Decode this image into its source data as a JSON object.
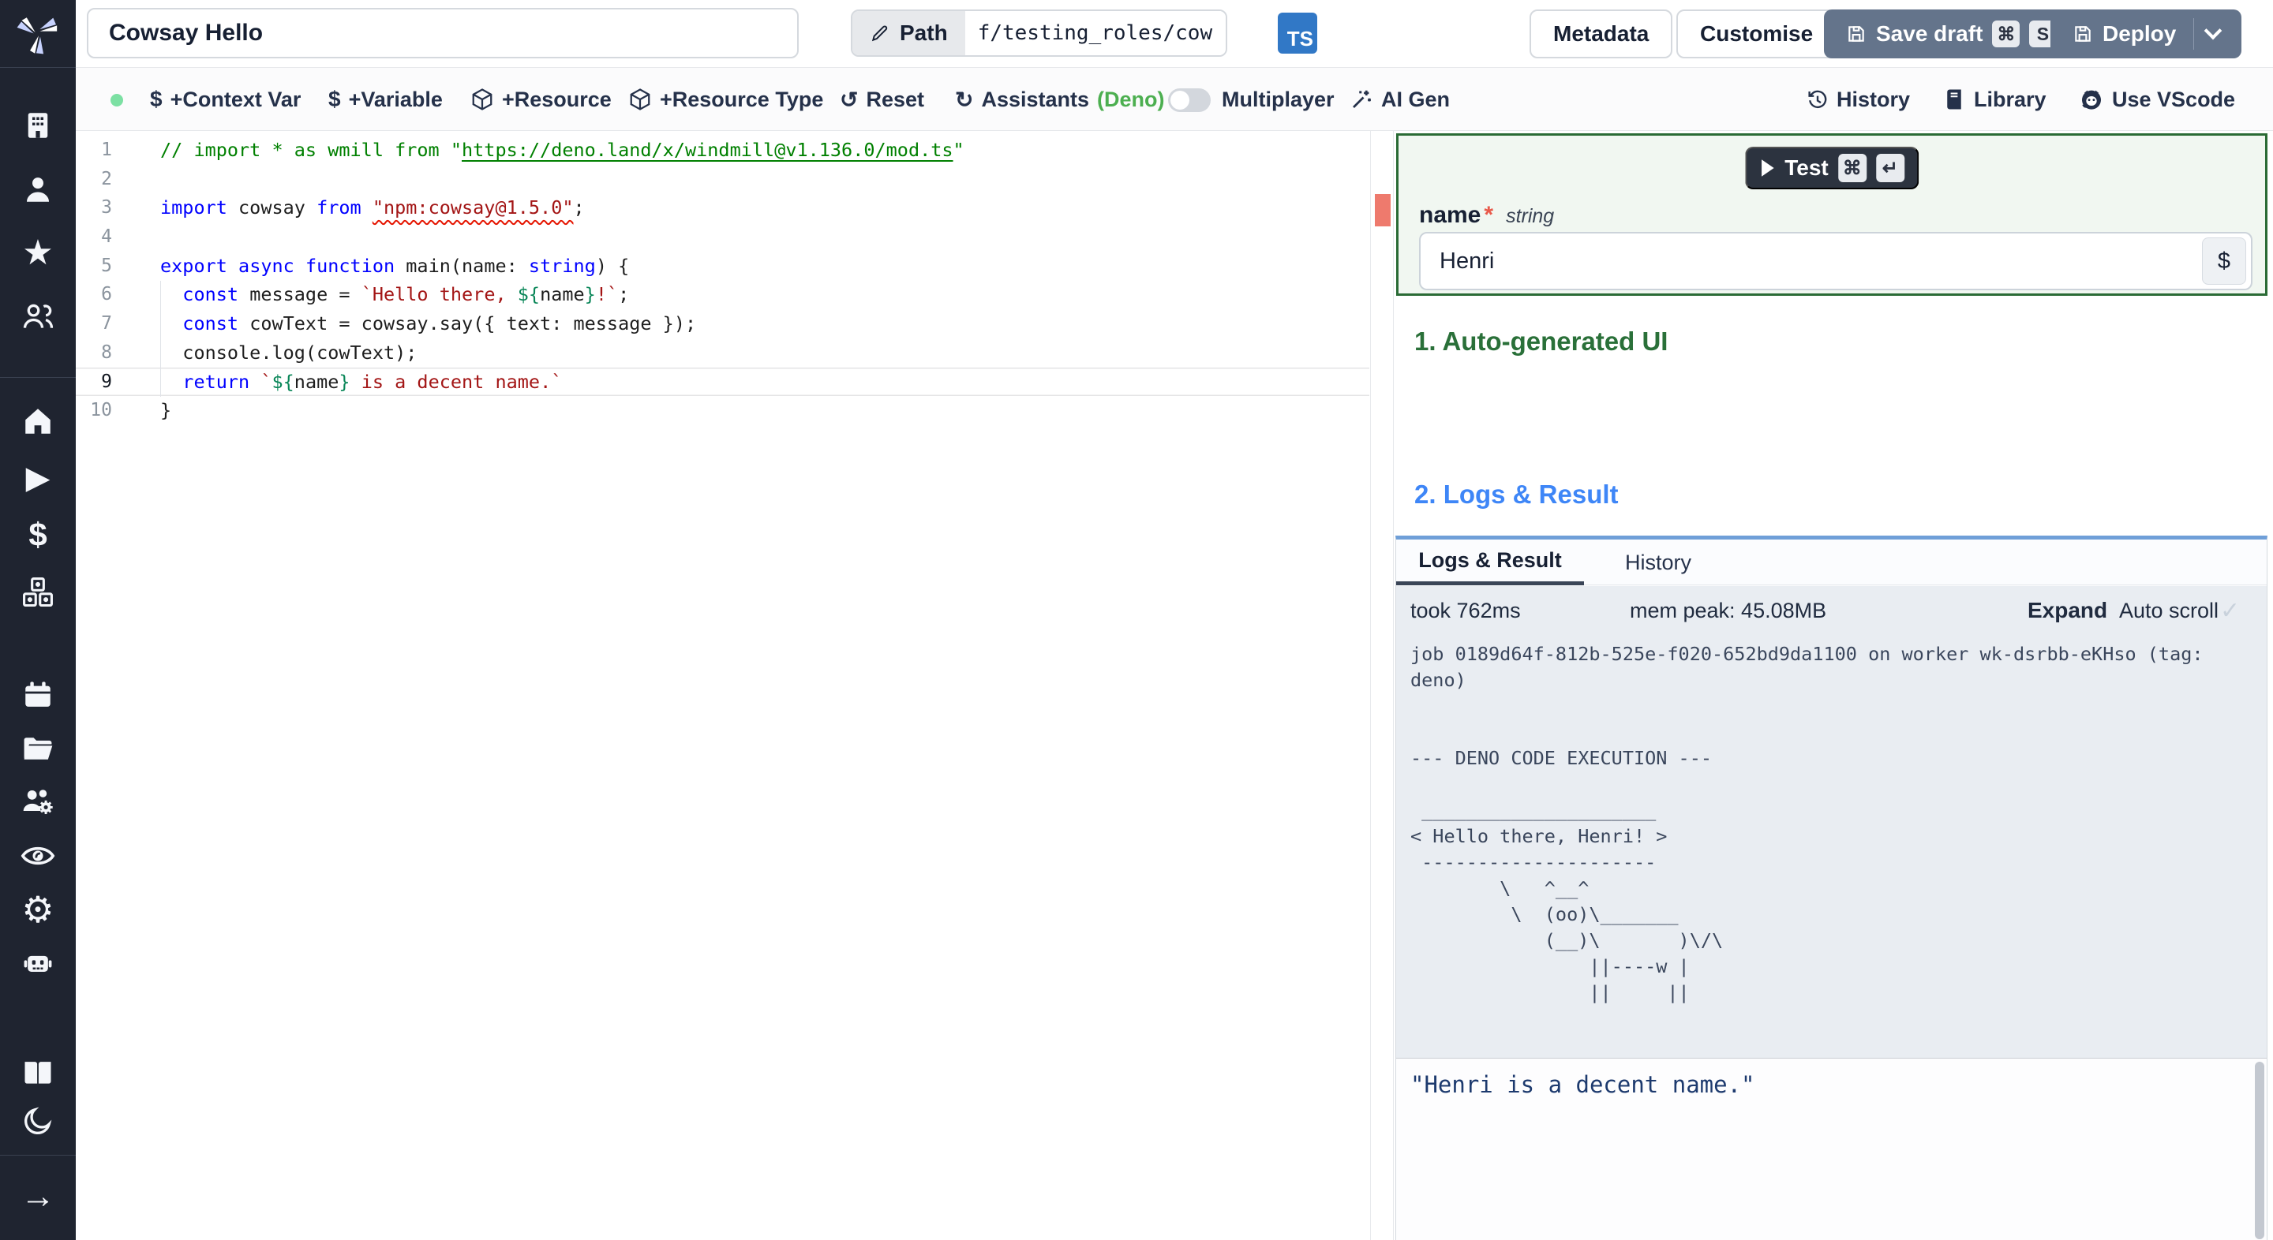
{
  "topbar": {
    "title_value": "Cowsay Hello",
    "path_label": "Path",
    "path_value": "f/testing_roles/cowsa",
    "lang_badge": "TS",
    "metadata_label": "Metadata",
    "customise_label": "Customise",
    "save_draft_label": "Save draft",
    "save_keys": [
      "⌘",
      "S"
    ],
    "deploy_label": "Deploy"
  },
  "toolbar": {
    "context_var": "+Context Var",
    "variable": "+Variable",
    "resource": "+Resource",
    "resource_type": "+Resource Type",
    "reset": "Reset",
    "assistants": "Assistants",
    "assistants_lang": "(Deno)",
    "multiplayer": "Multiplayer",
    "ai_gen": "AI Gen",
    "history": "History",
    "library": "Library",
    "vscode": "Use VScode"
  },
  "icons": {
    "dollar": "$",
    "undo": "↺",
    "refresh": "↻",
    "star": "★",
    "play": "▶",
    "arrow_right": "→",
    "gear": "⚙",
    "check": "✓"
  },
  "sidebar": {
    "icon_names": [
      "windmill-logo",
      "workspace-building",
      "user",
      "favorites-star",
      "user-groups",
      "home",
      "runs-play",
      "variables-dollar",
      "resources-cubes",
      "schedules-calendar",
      "folders",
      "workers-settings",
      "audit-eye",
      "settings-gear",
      "ai-robot",
      "docs-books",
      "dark-mode-moon",
      "expand-arrow"
    ]
  },
  "editor": {
    "lines": [
      {
        "num": 1,
        "tokens": [
          {
            "t": "// import * as wmill from \"",
            "c": "com"
          },
          {
            "t": "https://deno.land/x/windmill@v1.136.0/mod.ts",
            "c": "com-link"
          },
          {
            "t": "\"",
            "c": "com"
          }
        ]
      },
      {
        "num": 2,
        "tokens": []
      },
      {
        "num": 3,
        "tokens": [
          {
            "t": "import",
            "c": "kw"
          },
          {
            "t": " cowsay ",
            "c": "plain"
          },
          {
            "t": "from",
            "c": "kw"
          },
          {
            "t": " ",
            "c": "plain"
          },
          {
            "t": "\"npm:cowsay@1.5.0\"",
            "c": "str-err"
          },
          {
            "t": ";",
            "c": "plain"
          }
        ]
      },
      {
        "num": 4,
        "tokens": []
      },
      {
        "num": 5,
        "tokens": [
          {
            "t": "export",
            "c": "kw"
          },
          {
            "t": " ",
            "c": "plain"
          },
          {
            "t": "async",
            "c": "kw"
          },
          {
            "t": " ",
            "c": "plain"
          },
          {
            "t": "function",
            "c": "kw"
          },
          {
            "t": " main(name: ",
            "c": "plain"
          },
          {
            "t": "string",
            "c": "kw"
          },
          {
            "t": ") {",
            "c": "plain"
          }
        ]
      },
      {
        "num": 6,
        "tokens": [
          {
            "t": "  ",
            "c": "plain"
          },
          {
            "t": "const",
            "c": "kw"
          },
          {
            "t": " message = ",
            "c": "plain"
          },
          {
            "t": "`Hello there, ",
            "c": "str"
          },
          {
            "t": "${",
            "c": "delim"
          },
          {
            "t": "name",
            "c": "plain"
          },
          {
            "t": "}",
            "c": "delim"
          },
          {
            "t": "!`",
            "c": "str"
          },
          {
            "t": ";",
            "c": "plain"
          }
        ]
      },
      {
        "num": 7,
        "tokens": [
          {
            "t": "  ",
            "c": "plain"
          },
          {
            "t": "const",
            "c": "kw"
          },
          {
            "t": " cowText = cowsay.say({ text: message });",
            "c": "plain"
          }
        ]
      },
      {
        "num": 8,
        "tokens": [
          {
            "t": "  console.log(cowText);",
            "c": "plain"
          }
        ]
      },
      {
        "num": 9,
        "active": true,
        "tokens": [
          {
            "t": "  ",
            "c": "plain"
          },
          {
            "t": "return",
            "c": "kw"
          },
          {
            "t": " ",
            "c": "plain"
          },
          {
            "t": "`",
            "c": "str"
          },
          {
            "t": "${",
            "c": "delim"
          },
          {
            "t": "name",
            "c": "plain"
          },
          {
            "t": "}",
            "c": "delim"
          },
          {
            "t": " is a decent name.`",
            "c": "str"
          }
        ]
      },
      {
        "num": 10,
        "tokens": [
          {
            "t": "}",
            "c": "plain"
          }
        ]
      }
    ]
  },
  "preview": {
    "test_label": "Test",
    "test_keys": [
      "⌘",
      "↵"
    ],
    "arg_name": "name",
    "arg_required": "*",
    "arg_type": "string",
    "arg_value": "Henri",
    "var_picker_label": "$",
    "section1": "1. Auto-generated UI",
    "section2": "2. Logs & Result",
    "tab_logs": "Logs & Result",
    "tab_history": "History",
    "took": "took 762ms",
    "mem": "mem peak: 45.08MB",
    "expand": "Expand",
    "autoscroll": "Auto scroll",
    "log_text": "job 0189d64f-812b-525e-f020-652bd9da1100 on worker wk-dsrbb-eKHso (tag:\ndeno)\n\n\n--- DENO CODE EXECUTION ---\n\n _____________________\n< Hello there, Henri! >\n ---------------------\n        \\   ^__^\n         \\  (oo)\\_______\n            (__)\\       )\\/\\\n                ||----w |\n                ||     ||",
    "result_text": "\"Henri is a decent name.\""
  },
  "colors": {
    "rail_bg": "#1f2430",
    "primary_slate": "#64748b",
    "ts_badge_blue": "#3178c6",
    "panel_green_border": "#2a6b35",
    "section1_green": "#2a7039",
    "section2_blue": "#3e86f7",
    "deno_green": "#4caf50",
    "status_dot_green": "#7ce0a3",
    "error_marker_red": "#ee7a6d",
    "logs_focus_blue": "#6f9fd8"
  }
}
